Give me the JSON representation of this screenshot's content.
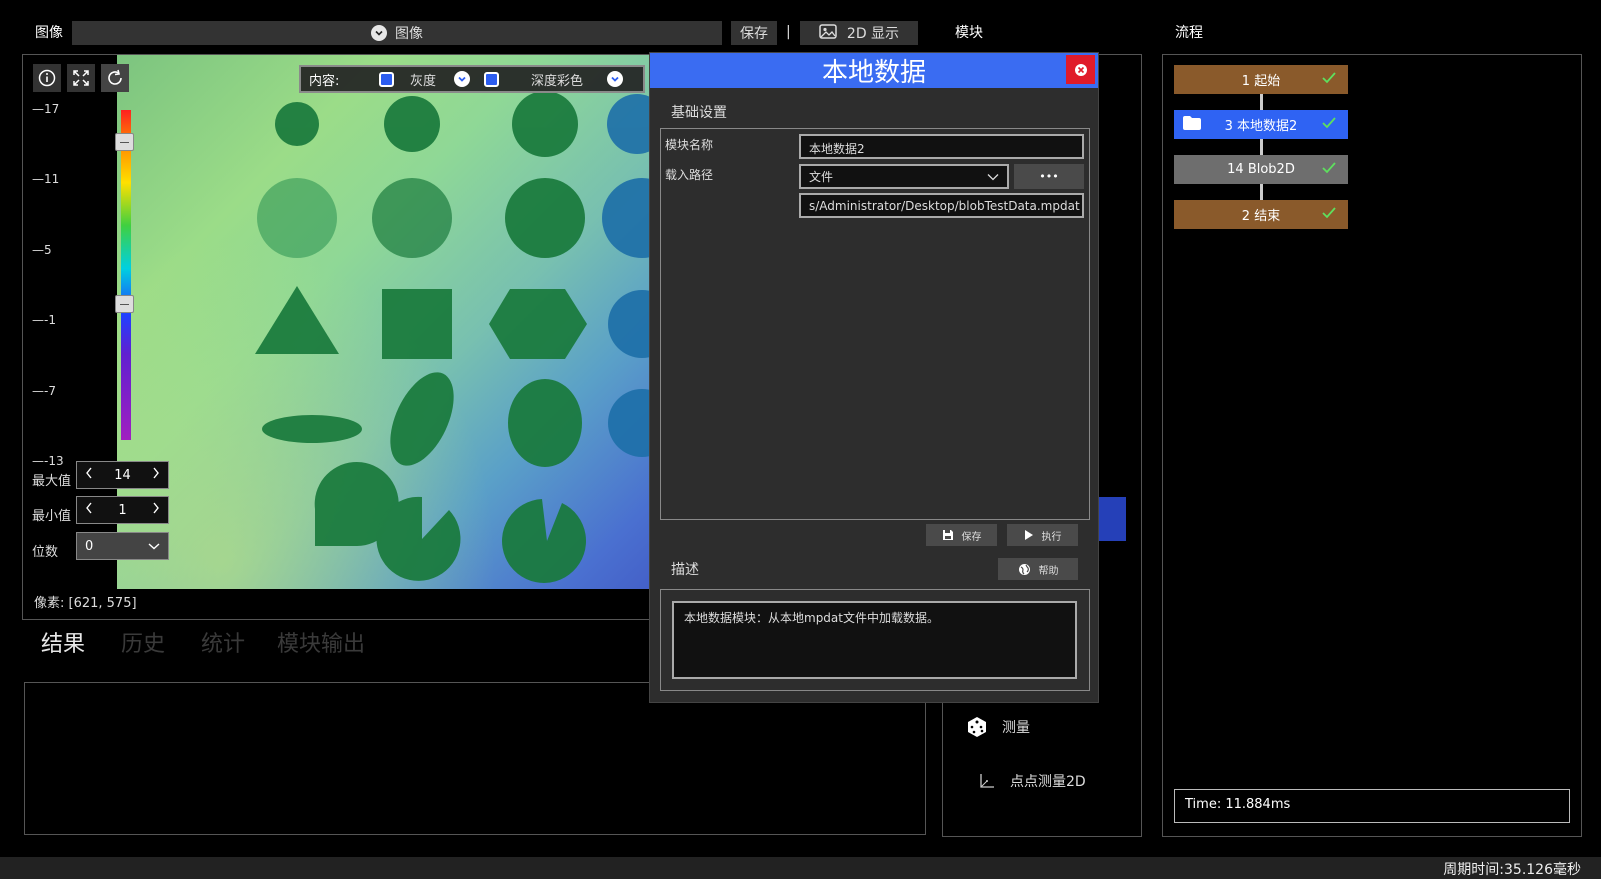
{
  "image_bar": {
    "label": "图像",
    "source_select": "图像",
    "save_label": "保存",
    "separator": "|",
    "display_label": "2D 显示"
  },
  "viewer": {
    "content_label": "内容:",
    "option_gray": "灰度",
    "option_depth": "深度彩色",
    "scale_ticks": [
      "17",
      "11",
      "5",
      "-1",
      "-7",
      "-13"
    ],
    "max_label": "最大值",
    "max_value": "14",
    "min_label": "最小值",
    "min_value": "1",
    "digits_label": "位数",
    "digits_value": "0",
    "pixel_readout": "像素: [621, 575]"
  },
  "tabs": [
    "结果",
    "历史",
    "统计",
    "模块输出"
  ],
  "modules": {
    "title": "模块",
    "items": [
      {
        "label": "测量",
        "icon": "dice-icon"
      },
      {
        "label": "点点测量2D",
        "icon": "axis-icon"
      }
    ]
  },
  "flow": {
    "title": "流程",
    "nodes": [
      {
        "label": "1 起始",
        "color": "#8a5a2b"
      },
      {
        "label": "3 本地数据2",
        "color": "#2f63f3"
      },
      {
        "label": "14 Blob2D",
        "color": "#6e6e6e"
      },
      {
        "label": "2 结束",
        "color": "#8a5a2b"
      }
    ],
    "time": "Time: 11.884ms"
  },
  "dialog": {
    "title": "本地数据",
    "basic_settings": "基础设置",
    "module_name_label": "模块名称",
    "module_name_value": "本地数据2",
    "load_path_label": "载入路径",
    "load_path_type": "文件",
    "browse_label": "•••",
    "path_value": "s/Administrator/Desktop/blobTestData.mpdat",
    "save_button": "保存",
    "run_button": "执行",
    "description_title": "描述",
    "help_button": "帮助",
    "description_text": "本地数据模块：从本地mpdat文件中加载数据。"
  },
  "status": {
    "cycle_time": "周期时间:35.126毫秒"
  },
  "colors": {
    "accent": "#3a6cf2",
    "close": "#e01b2a",
    "flow_start_end": "#8a5a2b",
    "flow_active": "#2f63f3",
    "flow_blob": "#6e6e6e",
    "check": "#5ee05e"
  }
}
